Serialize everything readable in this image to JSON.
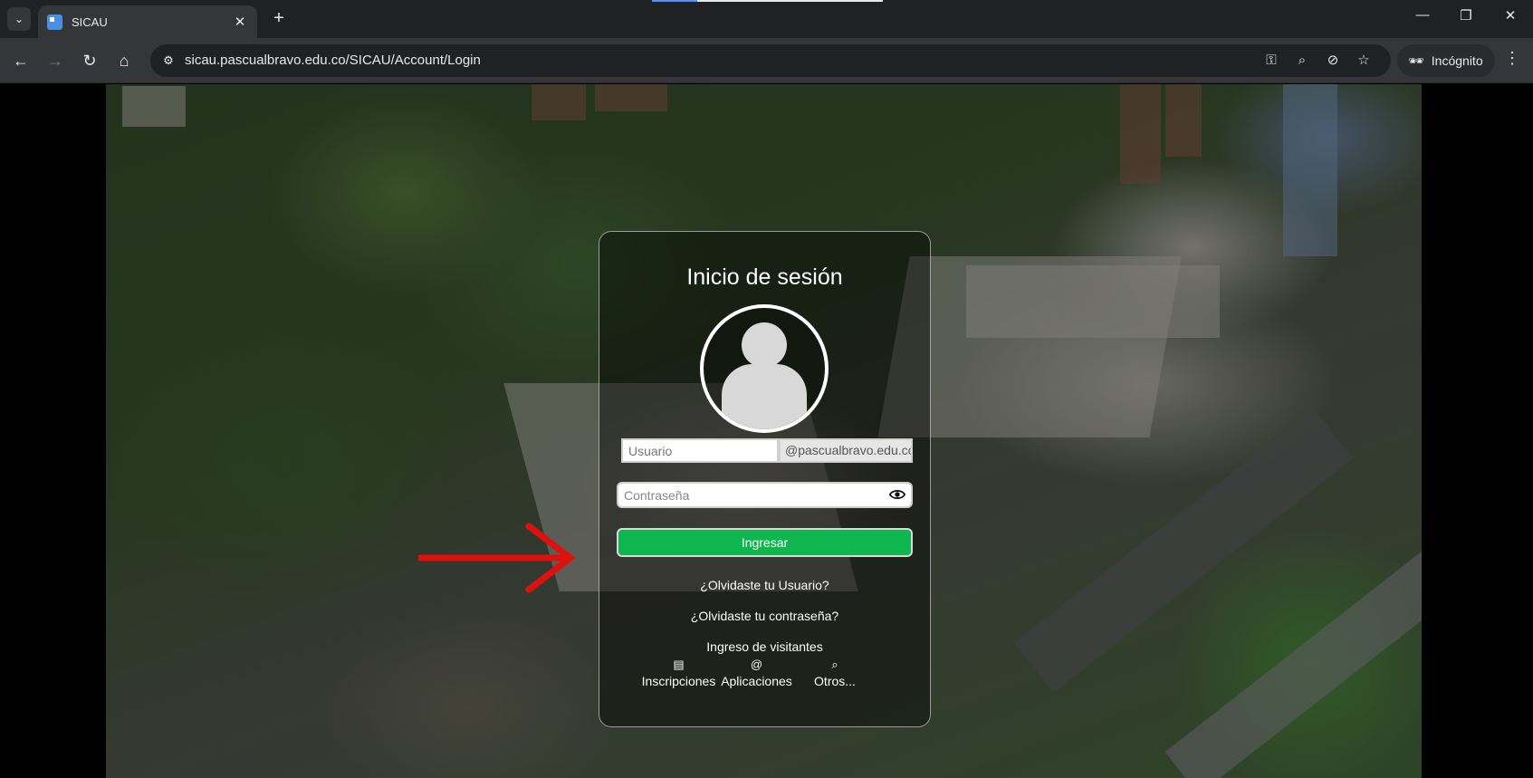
{
  "browser": {
    "tab_title": "SICAU",
    "new_tab_symbol": "+",
    "tab_close_symbol": "✕",
    "url": "sicau.pascualbravo.edu.co/SICAU/Account/Login",
    "incognito_label": "Incógnito",
    "icons": [
      "tab-list-icon",
      "back-icon",
      "forward-icon",
      "reload-icon",
      "home-icon",
      "site-info-icon",
      "password-key-icon",
      "zoom-icon",
      "eye-off-icon",
      "bookmark-star-icon",
      "incognito-icon",
      "menu-kebab-icon"
    ]
  },
  "login": {
    "title": "Inicio de sesión",
    "username_placeholder": "Usuario",
    "domain_suffix": "@pascualbravo.edu.co",
    "password_placeholder": "Contraseña",
    "submit_label": "Ingresar",
    "forgot_user": "¿Olvidaste tu Usuario?",
    "forgot_password": "¿Olvidaste tu contraseña?",
    "visitor_login": "Ingreso de visitantes",
    "bottom_links": {
      "inscripciones": "Inscripciones",
      "aplicaciones": "Aplicaciones",
      "otros": "Otros..."
    },
    "accent_color": "#0fb64f"
  },
  "annotation": {
    "arrow_color": "#e0100f"
  }
}
